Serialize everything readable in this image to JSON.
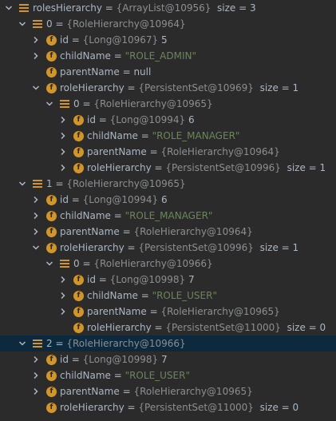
{
  "rows": [
    {
      "name": "rolesHierarchy",
      "value": "{ArrayList@10956}",
      "kind": "type",
      "size": "size = 3",
      "icon": "list",
      "arrow": "down",
      "level": 0,
      "selected": false
    },
    {
      "name": "0",
      "value": "{RoleHierarchy@10964}",
      "kind": "type",
      "size": "",
      "icon": "list",
      "arrow": "down",
      "level": 1,
      "selected": false
    },
    {
      "name": "id",
      "value": "{Long@10967} 5",
      "kind": "mixed",
      "size": "",
      "icon": "field",
      "arrow": "right",
      "level": 2,
      "selected": false
    },
    {
      "name": "childName",
      "value": "\"ROLE_ADMIN\"",
      "kind": "str",
      "size": "",
      "icon": "field",
      "arrow": "right",
      "level": 2,
      "selected": false
    },
    {
      "name": "parentName",
      "value": "null",
      "kind": "num",
      "size": "",
      "icon": "field",
      "arrow": "none",
      "level": 2,
      "selected": false
    },
    {
      "name": "roleHierarchy",
      "value": "{PersistentSet@10969}",
      "kind": "type",
      "size": "size = 1",
      "icon": "field",
      "arrow": "down",
      "level": 2,
      "selected": false
    },
    {
      "name": "0",
      "value": "{RoleHierarchy@10965}",
      "kind": "type",
      "size": "",
      "icon": "list",
      "arrow": "down",
      "level": 3,
      "selected": false
    },
    {
      "name": "id",
      "value": "{Long@10994} 6",
      "kind": "mixed",
      "size": "",
      "icon": "field",
      "arrow": "right",
      "level": 4,
      "selected": false
    },
    {
      "name": "childName",
      "value": "\"ROLE_MANAGER\"",
      "kind": "str",
      "size": "",
      "icon": "field",
      "arrow": "right",
      "level": 4,
      "selected": false
    },
    {
      "name": "parentName",
      "value": "{RoleHierarchy@10964}",
      "kind": "type",
      "size": "",
      "icon": "field",
      "arrow": "right",
      "level": 4,
      "selected": false
    },
    {
      "name": "roleHierarchy",
      "value": "{PersistentSet@10996}",
      "kind": "type",
      "size": "size = 1",
      "icon": "field",
      "arrow": "right",
      "level": 4,
      "selected": false
    },
    {
      "name": "1",
      "value": "{RoleHierarchy@10965}",
      "kind": "type",
      "size": "",
      "icon": "list",
      "arrow": "down",
      "level": 1,
      "selected": false
    },
    {
      "name": "id",
      "value": "{Long@10994} 6",
      "kind": "mixed",
      "size": "",
      "icon": "field",
      "arrow": "right",
      "level": 2,
      "selected": false
    },
    {
      "name": "childName",
      "value": "\"ROLE_MANAGER\"",
      "kind": "str",
      "size": "",
      "icon": "field",
      "arrow": "right",
      "level": 2,
      "selected": false
    },
    {
      "name": "parentName",
      "value": "{RoleHierarchy@10964}",
      "kind": "type",
      "size": "",
      "icon": "field",
      "arrow": "right",
      "level": 2,
      "selected": false
    },
    {
      "name": "roleHierarchy",
      "value": "{PersistentSet@10996}",
      "kind": "type",
      "size": "size = 1",
      "icon": "field",
      "arrow": "down",
      "level": 2,
      "selected": false
    },
    {
      "name": "0",
      "value": "{RoleHierarchy@10966}",
      "kind": "type",
      "size": "",
      "icon": "list",
      "arrow": "down",
      "level": 3,
      "selected": false
    },
    {
      "name": "id",
      "value": "{Long@10998} 7",
      "kind": "mixed",
      "size": "",
      "icon": "field",
      "arrow": "right",
      "level": 4,
      "selected": false
    },
    {
      "name": "childName",
      "value": "\"ROLE_USER\"",
      "kind": "str",
      "size": "",
      "icon": "field",
      "arrow": "right",
      "level": 4,
      "selected": false
    },
    {
      "name": "parentName",
      "value": "{RoleHierarchy@10965}",
      "kind": "type",
      "size": "",
      "icon": "field",
      "arrow": "right",
      "level": 4,
      "selected": false
    },
    {
      "name": "roleHierarchy",
      "value": "{PersistentSet@11000}",
      "kind": "type",
      "size": "size = 0",
      "icon": "field",
      "arrow": "none",
      "level": 4,
      "selected": false
    },
    {
      "name": "2",
      "value": "{RoleHierarchy@10966}",
      "kind": "type",
      "size": "",
      "icon": "list",
      "arrow": "down",
      "level": 1,
      "selected": true
    },
    {
      "name": "id",
      "value": "{Long@10998} 7",
      "kind": "mixed",
      "size": "",
      "icon": "field",
      "arrow": "right",
      "level": 2,
      "selected": false
    },
    {
      "name": "childName",
      "value": "\"ROLE_USER\"",
      "kind": "str",
      "size": "",
      "icon": "field",
      "arrow": "right",
      "level": 2,
      "selected": false
    },
    {
      "name": "parentName",
      "value": "{RoleHierarchy@10965}",
      "kind": "type",
      "size": "",
      "icon": "field",
      "arrow": "right",
      "level": 2,
      "selected": false
    },
    {
      "name": "roleHierarchy",
      "value": "{PersistentSet@11000}",
      "kind": "type",
      "size": "size = 0",
      "icon": "field",
      "arrow": "none",
      "level": 2,
      "selected": false
    }
  ],
  "colors": {
    "background": "#2b2b2b",
    "selected_row": "#0d293e",
    "icon_orange": "#d0962b",
    "string_green": "#6a8759",
    "type_gray": "#8b8f92",
    "text": "#a9b7c6"
  },
  "icons": {
    "field": "field-f-icon",
    "list": "list-lines-icon",
    "down": "chevron-down-icon",
    "right": "chevron-right-icon"
  }
}
